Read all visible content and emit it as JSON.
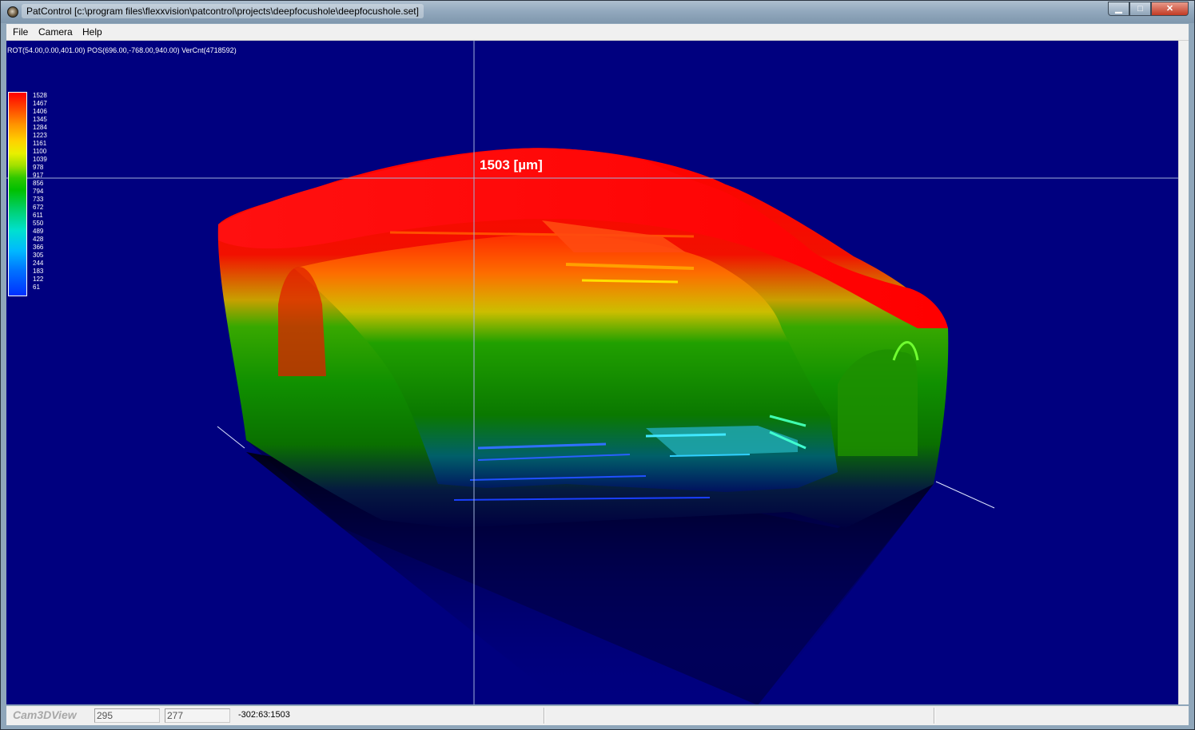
{
  "window": {
    "title": "PatControl [c:\\program files\\flexxvision\\patcontrol\\projects\\deepfocushole\\deepfocushole.set]",
    "minimize_glyph": "▁",
    "maximize_glyph": "□",
    "close_glyph": "✕"
  },
  "menu": {
    "items": [
      {
        "label": "File"
      },
      {
        "label": "Camera"
      },
      {
        "label": "Help"
      }
    ]
  },
  "view": {
    "info": "ROT(54.00,0.00,401.00) POS(696.00,-768.00,940.00) VerCnt(4718592)",
    "readout": "1503 [µm]",
    "background_color": "#00007f",
    "crosshair_color": "#9fb0d8"
  },
  "legend": {
    "values": [
      "1528",
      "1467",
      "1406",
      "1345",
      "1284",
      "1223",
      "1161",
      "1100",
      "1039",
      "978",
      "917",
      "856",
      "794",
      "733",
      "672",
      "611",
      "550",
      "489",
      "428",
      "366",
      "305",
      "244",
      "183",
      "122",
      "61"
    ]
  },
  "status": {
    "title": "Cam3DView",
    "x_value": "295",
    "y_value": "277",
    "coords": "-302:63:1503"
  }
}
